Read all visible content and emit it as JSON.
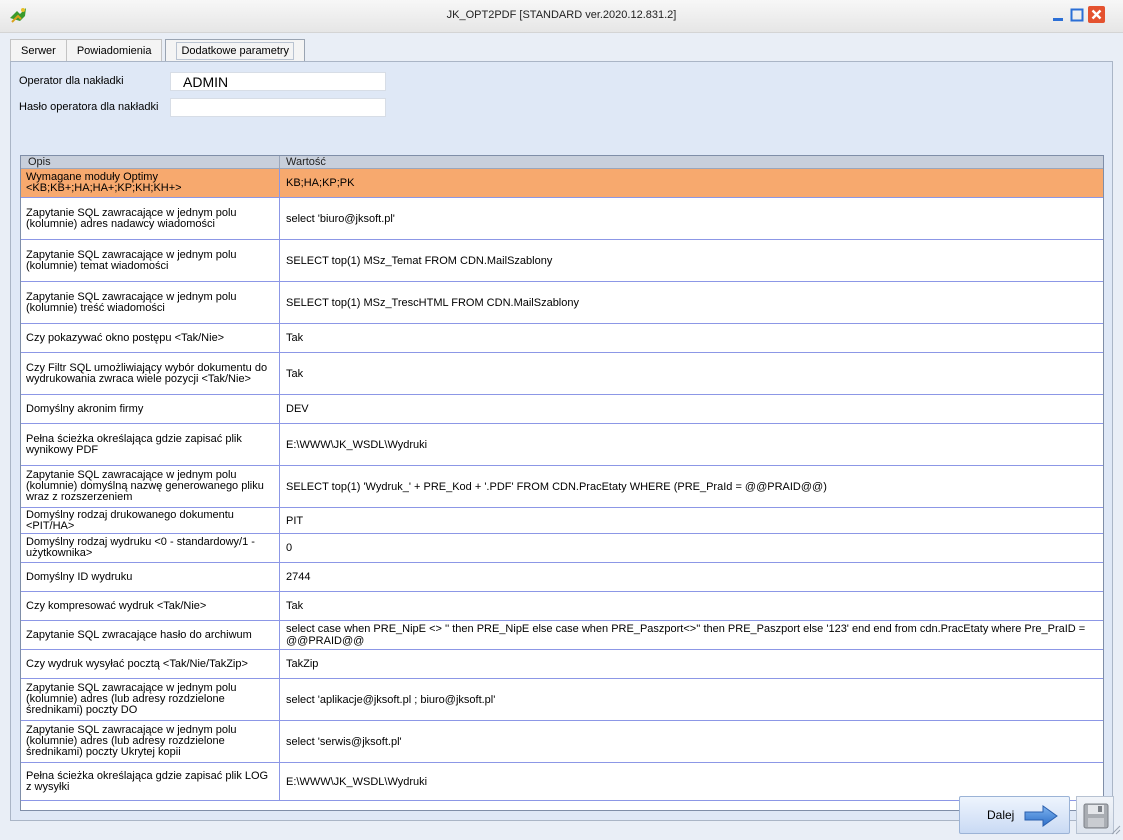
{
  "window": {
    "title": "JK_OPT2PDF [STANDARD ver.2020.12.831.2]"
  },
  "tabs": [
    {
      "label": "Serwer"
    },
    {
      "label": "Powiadomienia"
    },
    {
      "label": "Dodatkowe parametry"
    }
  ],
  "form": {
    "operator_label": "Operator dla nakładki",
    "operator_value": "ADMIN",
    "password_label": "Hasło operatora dla nakładki",
    "password_value": ""
  },
  "grid": {
    "header_desc": "Opis",
    "header_value": "Wartość",
    "rows": [
      {
        "desc": "Wymagane moduły Optimy <KB;KB+;HA;HA+;KP;KH;KH+>",
        "value": "KB;HA;KP;PK"
      },
      {
        "desc": "Zapytanie SQL zawracające w jednym polu (kolumnie) adres nadawcy wiadomości",
        "value": "select 'biuro@jksoft.pl'"
      },
      {
        "desc": "Zapytanie SQL zawracające w jednym polu (kolumnie) temat wiadomości",
        "value": "SELECT top(1) MSz_Temat FROM CDN.MailSzablony"
      },
      {
        "desc": "Zapytanie SQL zawracające w jednym polu (kolumnie) treść wiadomości",
        "value": "SELECT top(1) MSz_TrescHTML FROM CDN.MailSzablony"
      },
      {
        "desc": "Czy pokazywać okno postępu <Tak/Nie>",
        "value": "Tak"
      },
      {
        "desc": "Czy Filtr SQL umożliwiający wybór dokumentu do wydrukowania zwraca wiele pozycji <Tak/Nie>",
        "value": "Tak"
      },
      {
        "desc": "Domyślny akronim firmy",
        "value": "DEV"
      },
      {
        "desc": "Pełna ścieżka określająca gdzie zapisać plik wynikowy PDF",
        "value": "E:\\WWW\\JK_WSDL\\Wydruki"
      },
      {
        "desc": "Zapytanie SQL zawracające w jednym polu (kolumnie) domyślną nazwę generowanego pliku wraz z rozszerzeniem",
        "value": "SELECT  top(1) 'Wydruk_' + PRE_Kod + '.PDF' FROM CDN.PracEtaty WHERE (PRE_PraId = @@PRAID@@)"
      },
      {
        "desc": "Domyślny rodzaj drukowanego dokumentu <PIT/HA>",
        "value": "PIT"
      },
      {
        "desc": "Domyślny rodzaj wydruku <0 - standardowy/1 - użytkownika>",
        "value": "0"
      },
      {
        "desc": "Domyślny ID wydruku",
        "value": "2744"
      },
      {
        "desc": "Czy kompresować wydruk <Tak/Nie>",
        "value": "Tak"
      },
      {
        "desc": "Zapytanie SQL zwracające hasło do archiwum",
        "value": "select case when PRE_NipE <> '' then PRE_NipE else case when PRE_Paszport<>'' then PRE_Paszport else '123' end end from cdn.PracEtaty where Pre_PraID = @@PRAID@@"
      },
      {
        "desc": "Czy wydruk wysyłać pocztą <Tak/Nie/TakZip>",
        "value": "TakZip"
      },
      {
        "desc": "Zapytanie SQL zawracające w jednym polu (kolumnie) adres (lub adresy rozdzielone średnikami) poczty DO",
        "value": "select 'aplikacje@jksoft.pl ; biuro@jksoft.pl'"
      },
      {
        "desc": "Zapytanie SQL zawracające w jednym polu (kolumnie) adres (lub adresy rozdzielone średnikami) poczty Ukrytej kopii",
        "value": "select 'serwis@jksoft.pl'"
      },
      {
        "desc": "Pełna ścieżka określająca gdzie zapisać plik LOG z wysyłki",
        "value": "E:\\WWW\\JK_WSDL\\Wydruki"
      }
    ]
  },
  "buttons": {
    "next_label": "Dalej"
  },
  "colors": {
    "selected_row": "#f7a96e",
    "grid_lines": "#8c97e6",
    "panel_bg": "#dfe8f6"
  }
}
